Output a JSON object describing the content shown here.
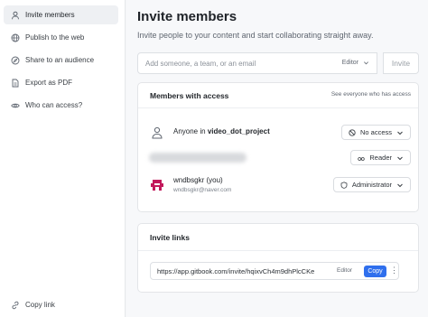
{
  "sidebar": {
    "items": [
      {
        "label": "Invite members",
        "icon": "person-icon",
        "active": true
      },
      {
        "label": "Publish to the web",
        "icon": "globe-icon"
      },
      {
        "label": "Share to an audience",
        "icon": "compass-icon"
      },
      {
        "label": "Export as PDF",
        "icon": "pdf-icon"
      },
      {
        "label": "Who can access?",
        "icon": "eye-icon"
      }
    ],
    "copy_link": "Copy link"
  },
  "main": {
    "title": "Invite members",
    "subtitle": "Invite people to your content and start collaborating straight away.",
    "invite": {
      "placeholder": "Add someone, a team, or an email",
      "role": "Editor",
      "button": "Invite"
    },
    "members": {
      "title": "Members with access",
      "see_all": "See everyone who has access",
      "anyone_prefix": "Anyone in",
      "project": "video_dot_project",
      "anyone_access": "No access",
      "hidden_access": "Reader",
      "user_name": "wndbsgkr (you)",
      "user_email": "wndbsgkr@naver.com",
      "user_access": "Administrator"
    },
    "links": {
      "title": "Invite links",
      "url": "https://app.gitbook.com/invite/hqixvCh4m9dhPlcCKe",
      "role": "Editor",
      "copy": "Copy",
      "more": "⋮"
    }
  },
  "colors": {
    "accent": "#2f6fed",
    "avatar": "#c2185b"
  }
}
